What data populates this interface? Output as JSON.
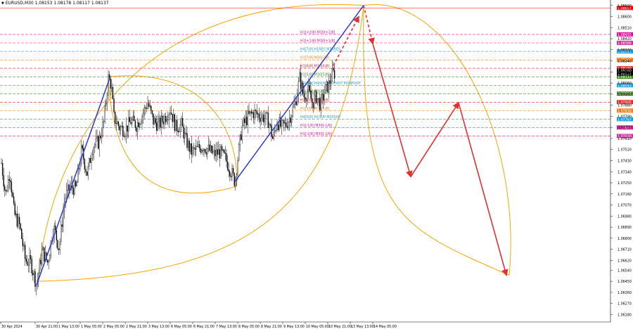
{
  "header": {
    "symbol_info": "EURUSD,M30  1.08153 1.08178 1.08117 1.08137"
  },
  "chart_data": {
    "type": "candlestick",
    "symbol": "EURUSD",
    "timeframe": "M30",
    "ohlc_last": {
      "open": 1.08153,
      "high": 1.08178,
      "low": 1.08117,
      "close": 1.08137
    },
    "y_range": [
      1.0612,
      1.087
    ],
    "y_ticks": [
      {
        "label": "1.08690",
        "v": 1.0869
      },
      {
        "label": "1.08600",
        "v": 1.086
      },
      {
        "label": "1.08510",
        "v": 1.0851
      },
      {
        "label": "1.08420",
        "v": 1.0842
      },
      {
        "label": "1.08330",
        "v": 1.0833
      },
      {
        "label": "1.08240",
        "v": 1.0824
      },
      {
        "label": "1.08150",
        "v": 1.0815
      },
      {
        "label": "1.08060",
        "v": 1.0806
      },
      {
        "label": "1.07970",
        "v": 1.0797
      },
      {
        "label": "1.07880",
        "v": 1.0788
      },
      {
        "label": "1.07790",
        "v": 1.0779
      },
      {
        "label": "1.07700",
        "v": 1.077
      },
      {
        "label": "1.07610",
        "v": 1.0761
      },
      {
        "label": "1.07520",
        "v": 1.0752
      },
      {
        "label": "1.07430",
        "v": 1.0743
      },
      {
        "label": "1.07340",
        "v": 1.0734
      },
      {
        "label": "1.07250",
        "v": 1.0725
      },
      {
        "label": "1.07160",
        "v": 1.0716
      },
      {
        "label": "1.07070",
        "v": 1.0707
      },
      {
        "label": "1.06980",
        "v": 1.0698
      },
      {
        "label": "1.06890",
        "v": 1.0689
      },
      {
        "label": "1.06800",
        "v": 1.068
      },
      {
        "label": "1.06710",
        "v": 1.0671
      },
      {
        "label": "1.06620",
        "v": 1.0662
      },
      {
        "label": "1.06540",
        "v": 1.0654
      },
      {
        "label": "1.06450",
        "v": 1.0645
      },
      {
        "label": "1.06360",
        "v": 1.0636
      },
      {
        "label": "1.06270",
        "v": 1.0627
      },
      {
        "label": "1.06180",
        "v": 1.0618
      }
    ],
    "x_labels": [
      {
        "label": "30 Apr 2024",
        "i": 0
      },
      {
        "label": "30 Apr 21:00",
        "i": 48
      },
      {
        "label": "1 May 13:00",
        "i": 80
      },
      {
        "label": "1 May 05:00",
        "i": 112
      },
      {
        "label": "2 May 05:00",
        "i": 144
      },
      {
        "label": "2 May 21:00",
        "i": 176
      },
      {
        "label": "3 May 13:00",
        "i": 208
      },
      {
        "label": "6 May 05:00",
        "i": 240
      },
      {
        "label": "6 May 21:00",
        "i": 272
      },
      {
        "label": "7 May 13:00",
        "i": 304
      },
      {
        "label": "8 May 05:00",
        "i": 336
      },
      {
        "label": "8 May 21:00",
        "i": 368
      },
      {
        "label": "9 May 13:00",
        "i": 400
      },
      {
        "label": "10 May 05:00",
        "i": 432
      },
      {
        "label": "10 May 21:00",
        "i": 464
      },
      {
        "label": "13 May 13:00",
        "i": 496
      },
      {
        "label": "14 May 05:00",
        "i": 528
      }
    ],
    "bars_count": 560,
    "price_path": [
      [
        0,
        1.0741
      ],
      [
        6,
        1.0715
      ],
      [
        12,
        1.0735
      ],
      [
        18,
        1.07
      ],
      [
        26,
        1.069
      ],
      [
        34,
        1.0662
      ],
      [
        42,
        1.066
      ],
      [
        50,
        1.0642
      ],
      [
        58,
        1.067
      ],
      [
        66,
        1.066
      ],
      [
        74,
        1.069
      ],
      [
        82,
        1.0672
      ],
      [
        90,
        1.0712
      ],
      [
        98,
        1.0722
      ],
      [
        106,
        1.072
      ],
      [
        114,
        1.0752
      ],
      [
        122,
        1.0732
      ],
      [
        130,
        1.0755
      ],
      [
        138,
        1.0758
      ],
      [
        146,
        1.0775
      ],
      [
        152,
        1.081
      ],
      [
        156,
        1.0805
      ],
      [
        160,
        1.0778
      ],
      [
        168,
        1.077
      ],
      [
        176,
        1.0768
      ],
      [
        184,
        1.0775
      ],
      [
        192,
        1.0772
      ],
      [
        200,
        1.078
      ],
      [
        208,
        1.079
      ],
      [
        216,
        1.0775
      ],
      [
        224,
        1.0772
      ],
      [
        232,
        1.0778
      ],
      [
        240,
        1.0785
      ],
      [
        248,
        1.077
      ],
      [
        256,
        1.0772
      ],
      [
        262,
        1.076
      ],
      [
        270,
        1.075
      ],
      [
        278,
        1.0752
      ],
      [
        286,
        1.0755
      ],
      [
        294,
        1.0752
      ],
      [
        302,
        1.0748
      ],
      [
        310,
        1.075
      ],
      [
        318,
        1.0745
      ],
      [
        326,
        1.0735
      ],
      [
        332,
        1.0726
      ],
      [
        336,
        1.0745
      ],
      [
        342,
        1.077
      ],
      [
        350,
        1.0778
      ],
      [
        358,
        1.0782
      ],
      [
        366,
        1.078
      ],
      [
        374,
        1.0778
      ],
      [
        380,
        1.0775
      ],
      [
        386,
        1.076
      ],
      [
        392,
        1.0775
      ],
      [
        398,
        1.077
      ],
      [
        404,
        1.0772
      ],
      [
        410,
        1.0778
      ],
      [
        418,
        1.079
      ],
      [
        424,
        1.081
      ],
      [
        430,
        1.0795
      ],
      [
        436,
        1.08
      ],
      [
        442,
        1.079
      ],
      [
        448,
        1.0795
      ],
      [
        454,
        1.0788
      ],
      [
        460,
        1.08
      ],
      [
        466,
        1.0805
      ],
      [
        470,
        1.0813
      ],
      [
        474,
        1.0814
      ]
    ],
    "levels": [
      {
        "label": "H1[+2/8] M30[+2/8]",
        "price": 1.08455,
        "color": "#e0109a",
        "dash": "4,2",
        "tag_bg": "#e0109a",
        "tag": "1.08455"
      },
      {
        "label": "H1[+1/8] M30[+1/8]",
        "price": 1.08386,
        "color": "#e0109a",
        "dash": "4,2",
        "tag_bg": "#cc3399",
        "tag": "1.08386"
      },
      {
        "label": "H4[7/8] H1RES M30RES",
        "price": 1.08317,
        "color": "#1e9fe0",
        "dash": "4,2",
        "tag_bg": "#1e9fe0",
        "tag": "1.08317"
      },
      {
        "label": "H1[7/8] M30[7/8]",
        "price": 1.08248,
        "color": "#f07d1b",
        "dash": "4,2",
        "tag_bg": "#f07d1b",
        "tag": "1.08248"
      },
      {
        "label": "H1[6/8] M30[6/8]",
        "price": 1.0818,
        "color": "#dd2a2a",
        "dash": "4,2",
        "tag_bg": "#dd2a2a",
        "tag": "1.08180"
      },
      {
        "label": "H1[5/8] M30[5/8]",
        "price": 1.08111,
        "color": "#4a8a2a",
        "dash": "4,2",
        "tag_bg": "#4a8a2a",
        "tag": "1.08111"
      },
      {
        "label": "D1[5/8] H4[6/8] H1PIVOT M30PIVOT",
        "price": 1.08042,
        "color": "#1e9fe0",
        "dash": "4,2",
        "tag_bg": "#1e9fe0",
        "tag": "1.08042"
      },
      {
        "label": "H1[3/8] M30[3/8]",
        "price": 1.07974,
        "color": "#4a8a2a",
        "dash": "4,2",
        "tag_bg": "#4a8a2a",
        "tag": "1.07974"
      },
      {
        "label": "H1[2/8] M30[2/8]",
        "price": 1.07905,
        "color": "#dd2a2a",
        "dash": "4,2",
        "tag_bg": "#dd2a2a",
        "tag": "1.07905"
      },
      {
        "label": "H1[1/8] M30[1/8]",
        "price": 1.07836,
        "color": "#f07d1b",
        "dash": "4,2",
        "tag_bg": "#f07d1b",
        "tag": "1.07836"
      },
      {
        "label": "H4[5/8] H1SUP M30SUP",
        "price": 1.07767,
        "color": "#1e9fe0",
        "dash": "4,2",
        "tag_bg": "#1e9fe0",
        "tag": "1.07767"
      },
      {
        "label": "H1[-1/8] M30[-1/8]",
        "price": 1.07699,
        "color": "#e0109a",
        "dash": "4,2",
        "tag_bg": "#e0109a",
        "tag": "1.07699"
      },
      {
        "label": "H1[-2/8] M30[-2/8]",
        "price": 1.0763,
        "color": "#e0109a",
        "dash": "4,2",
        "tag_bg": "#cc3399",
        "tag": "1.07630"
      }
    ],
    "extra_tags": [
      {
        "tag": "1.08137",
        "price": 1.08137,
        "bg": "#000000"
      },
      {
        "tag": "1.08160",
        "price": 1.0816,
        "bg": "#000000"
      }
    ],
    "bid_line": {
      "price": 1.0867,
      "color": "#ff0000",
      "tag": "1.08657",
      "bg": "#ff0000"
    },
    "trend_lines": [
      {
        "from": [
          50,
          1.0642
        ],
        "to": [
          154,
          1.081
        ],
        "color": "#3344cc"
      },
      {
        "from": [
          332,
          1.0726
        ],
        "to": [
          515,
          1.0869
        ],
        "color": "#3344cc"
      }
    ],
    "forecast": {
      "color": "#e03030",
      "points": [
        [
          515,
          1.0869
        ],
        [
          528,
          1.0838
        ],
        [
          582,
          1.073
        ],
        [
          650,
          1.079
        ],
        [
          718,
          1.065
        ]
      ],
      "dashed_segments": [
        [
          0,
          1
        ]
      ],
      "arrows": [
        [
          472,
          1.082,
          508,
          1.086
        ]
      ]
    },
    "arcs_color": "#f5a800"
  }
}
